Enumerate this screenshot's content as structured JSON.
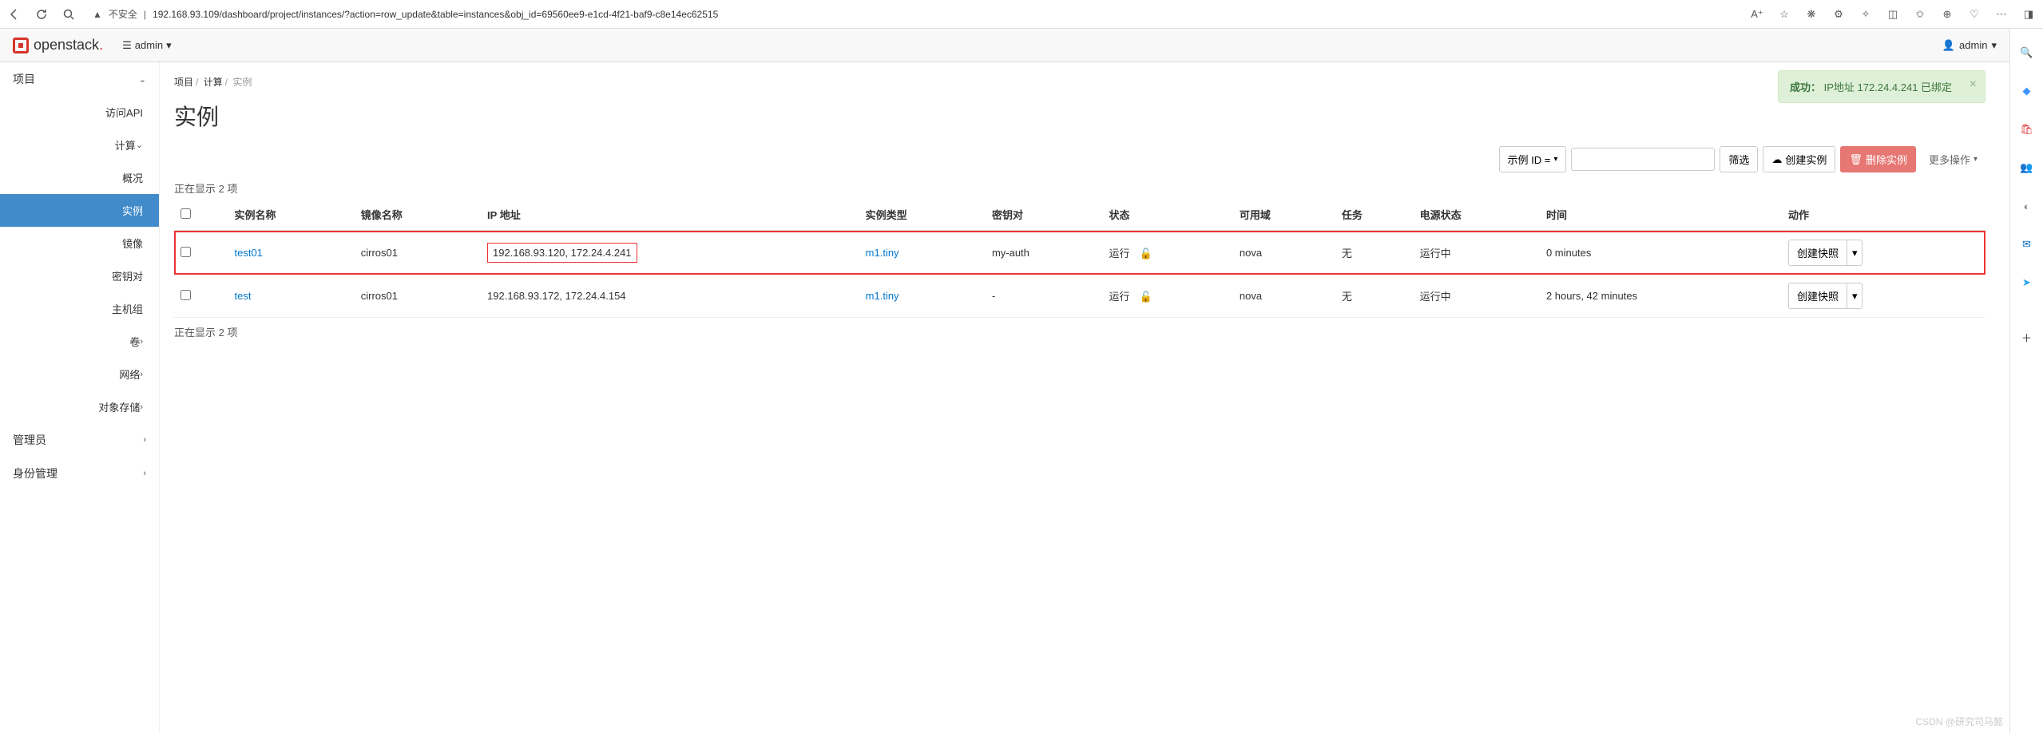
{
  "browser": {
    "url": "192.168.93.109/dashboard/project/instances/?action=row_update&table=instances&obj_id=69560ee9-e1cd-4f21-baf9-c8e14ec62515",
    "insecure_label": "不安全"
  },
  "topbar": {
    "brand": "openstack",
    "project_label": "admin",
    "user_label": "admin"
  },
  "sidebar": {
    "project": "项目",
    "apiaccess": "访问API",
    "compute": "计算",
    "overview": "概况",
    "instances": "实例",
    "images": "镜像",
    "keypairs": "密钥对",
    "servergroups": "主机组",
    "volumes": "卷",
    "network": "网络",
    "objectstore": "对象存储",
    "admin": "管理员",
    "identity": "身份管理"
  },
  "breadcrumb": {
    "a": "项目",
    "b": "计算",
    "c": "实例"
  },
  "page_title": "实例",
  "alert": {
    "prefix": "成功：",
    "msg": "IP地址 172.24.4.241 已绑定"
  },
  "toolbar": {
    "filter_sel": "示例 ID =",
    "filter_btn": "筛选",
    "launch_btn": "创建实例",
    "delete_btn": "删除实例",
    "more_btn": "更多操作"
  },
  "showing": "正在显示 2 项",
  "columns": {
    "name": "实例名称",
    "image": "镜像名称",
    "ip": "IP 地址",
    "flavor": "实例类型",
    "keypair": "密钥对",
    "status": "状态",
    "az": "可用域",
    "task": "任务",
    "power": "电源状态",
    "age": "时间",
    "actions": "动作"
  },
  "rows": [
    {
      "name": "test01",
      "image": "cirros01",
      "ip": "192.168.93.120, 172.24.4.241",
      "flavor": "m1.tiny",
      "keypair": "my-auth",
      "status": "运行",
      "az": "nova",
      "task": "无",
      "power": "运行中",
      "age": "0 minutes",
      "action": "创建快照",
      "hl": true
    },
    {
      "name": "test",
      "image": "cirros01",
      "ip": "192.168.93.172, 172.24.4.154",
      "flavor": "m1.tiny",
      "keypair": "-",
      "status": "运行",
      "az": "nova",
      "task": "无",
      "power": "运行中",
      "age": "2 hours, 42 minutes",
      "action": "创建快照",
      "hl": false
    }
  ],
  "watermark": "CSDN @研究司马懿"
}
